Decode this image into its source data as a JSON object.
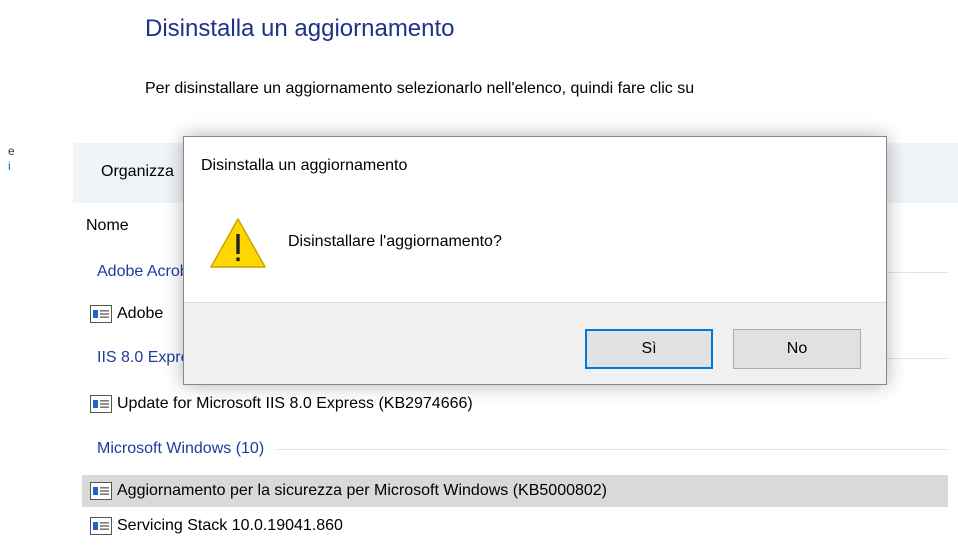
{
  "page": {
    "title": "Disinstalla un aggiornamento",
    "description": "Per disinstallare un aggiornamento selezionarlo nell'elenco, quindi fare clic su",
    "left_edge_text_1": "e",
    "left_edge_text_2": "i"
  },
  "toolbar": {
    "organize_label": "Organizza"
  },
  "list": {
    "column_header": "Nome",
    "groups": [
      {
        "label": "Adobe Acrobat"
      },
      {
        "label": "IIS 8.0 Express"
      },
      {
        "label": "Microsoft Windows (10)"
      }
    ],
    "items": [
      {
        "label": "Adobe"
      },
      {
        "label": "Update for Microsoft IIS 8.0 Express (KB2974666)"
      },
      {
        "label": "Aggiornamento per la sicurezza per Microsoft Windows (KB5000802)",
        "selected": true
      },
      {
        "label": "Servicing Stack 10.0.19041.860"
      }
    ]
  },
  "dialog": {
    "title": "Disinstalla un aggiornamento",
    "message": "Disinstallare l'aggiornamento?",
    "icon": "warning-icon",
    "yes_label": "Sì",
    "no_label": "No"
  },
  "colors": {
    "title_blue": "#1e3287",
    "group_blue": "#1e3c9c",
    "toolbar_bg": "#f0f4f9",
    "selected_bg": "#d9d9d9",
    "dialog_footer_bg": "#f0f0f0",
    "default_button_border": "#0078d7",
    "warning_yellow": "#ffd700"
  }
}
